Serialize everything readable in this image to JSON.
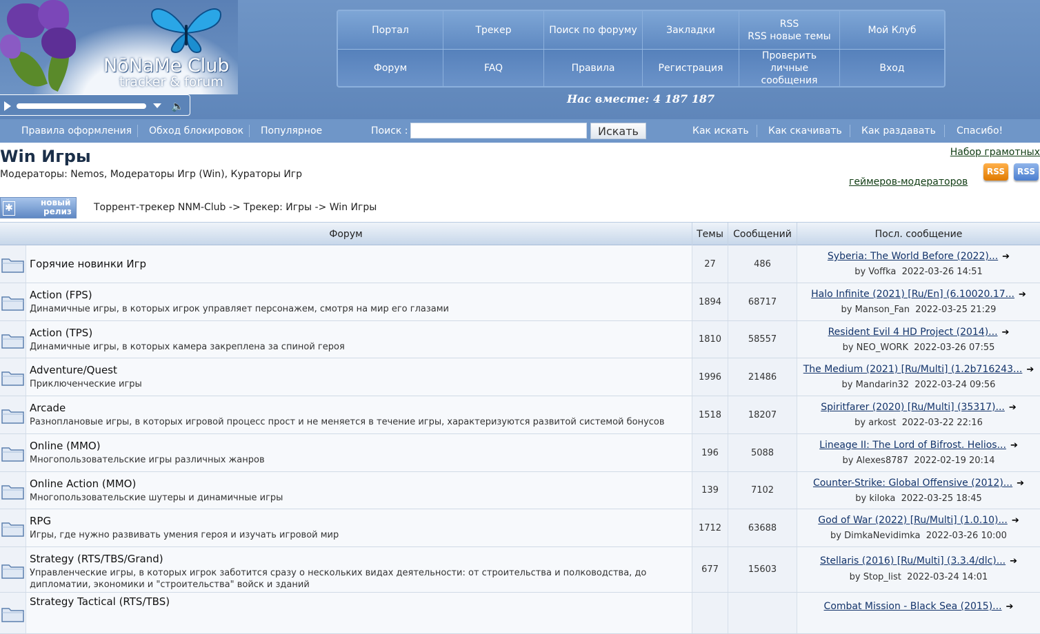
{
  "header": {
    "logo_title": "NōNaMe Club",
    "logo_subtitle": "tracker & forum",
    "together_text": "Нас вместе: 4 187 187",
    "nav_row1": [
      "Портал",
      "Трекер",
      "Поиск по форуму",
      "Закладки",
      "RSS",
      "Мой Клуб"
    ],
    "rss_sub": "RSS новые темы",
    "nav_row2": [
      "Форум",
      "FAQ",
      "Правила",
      "Регистрация",
      "Проверить личные сообщения",
      "Вход"
    ]
  },
  "subnav": {
    "left_links": [
      "Правила оформления",
      "Обход блокировок",
      "Популярное"
    ],
    "search_label": "Поиск :",
    "search_value": "",
    "search_button": "Искать",
    "right_links": [
      "Как искать",
      "Как скачивать",
      "Как раздавать",
      "Спасибо!"
    ]
  },
  "page": {
    "title": "Win Игры",
    "moderators": "Модераторы: Nemos, Модераторы Игр (Win), Кураторы Игр",
    "recruit_link_1": "Набор грамотных",
    "recruit_link_2": "геймеров-модераторов",
    "rss_badge": "RSS",
    "new_release_1": "новый",
    "new_release_2": "релиз",
    "breadcrumb": [
      "Торрент-трекер NNM-Club",
      "Трекер: Игры",
      "Win Игры"
    ],
    "breadcrumb_sep": " -> "
  },
  "table": {
    "headers": [
      "Форум",
      "Темы",
      "Сообщений",
      "Посл. сообщение"
    ],
    "by_label": "by",
    "rows": [
      {
        "name": "Горячие новинки Игр",
        "desc": "",
        "topics": "27",
        "posts": "486",
        "last_title": "Syberia: The World Before (2022)...",
        "last_user": "Voffka",
        "last_time": "2022-03-26 14:51"
      },
      {
        "name": "Action (FPS)",
        "desc": "Динамичные игры, в которых игрок управляет персонажем, смотря на мир его глазами",
        "topics": "1894",
        "posts": "68717",
        "last_title": "Halo Infinite (2021) [Ru/En] (6.10020.17...",
        "last_user": "Manson_Fan",
        "last_time": "2022-03-25 21:29"
      },
      {
        "name": "Action (TPS)",
        "desc": "Динамичные игры, в которых камера закреплена за спиной героя",
        "topics": "1810",
        "posts": "58557",
        "last_title": "Resident Evil 4 HD Project (2014)...",
        "last_user": "NEO_WORK",
        "last_time": "2022-03-26 07:55"
      },
      {
        "name": "Adventure/Quest",
        "desc": "Приключенческие игры",
        "topics": "1996",
        "posts": "21486",
        "last_title": "The Medium (2021) [Ru/Multi] (1.2b716243...",
        "last_user": "Mandarin32",
        "last_time": "2022-03-24 09:56"
      },
      {
        "name": "Arcade",
        "desc": "Разноплановые игры, в которых игровой процесс прост и не меняется в течение игры, характеризуются развитой системой бонусов",
        "topics": "1518",
        "posts": "18207",
        "last_title": "Spiritfarer (2020) [Ru/Multi] (35317)...",
        "last_user": "arkost",
        "last_time": "2022-03-22 22:16"
      },
      {
        "name": "Online (MMO)",
        "desc": "Многопользовательские игры различных жанров",
        "topics": "196",
        "posts": "5088",
        "last_title": "Lineage II: The Lord of Bifrost. Helios...",
        "last_user": "Alexes8787",
        "last_time": "2022-02-19 20:14"
      },
      {
        "name": "Online Action (MMO)",
        "desc": "Многопользовательские шутеры и динамичные игры",
        "topics": "139",
        "posts": "7102",
        "last_title": "Counter-Strike: Global Offensive (2012)...",
        "last_user": "kiloka",
        "last_time": "2022-03-25 18:45"
      },
      {
        "name": "RPG",
        "desc": "Игры, где нужно развивать умения героя и изучать игровой мир",
        "topics": "1712",
        "posts": "63688",
        "last_title": "God of War (2022) [Ru/Multi] (1.0.10)...",
        "last_user": "DimkaNevidimka",
        "last_time": "2022-03-26 10:00"
      },
      {
        "name": "Strategy (RTS/TBS/Grand)",
        "desc": "Управленческие игры, в которых игрок заботится сразу о нескольких видах деятельности: от строительства и полководства, до дипломатии, экономики и \"строительства\" войск и зданий",
        "topics": "677",
        "posts": "15603",
        "last_title": "Stellaris (2016) [Ru/Multi] (3.3.4/dlc)...",
        "last_user": "Stop_list",
        "last_time": "2022-03-24 14:01"
      },
      {
        "name": "Strategy Tactical (RTS/TBS)",
        "desc": "",
        "topics": "",
        "posts": "",
        "last_title": "Combat Mission - Black Sea (2015)...",
        "last_user": "",
        "last_time": ""
      }
    ]
  },
  "colors": {
    "header_bg": "#6f95c6",
    "subnav_bg": "#6f96c8",
    "link": "#12336a",
    "title": "#1b2f49"
  },
  "icons": [
    "play-icon",
    "dropdown-icon",
    "volume-icon",
    "folder-icon",
    "goto-last-post-icon",
    "rss-icon",
    "new-release-icon"
  ]
}
